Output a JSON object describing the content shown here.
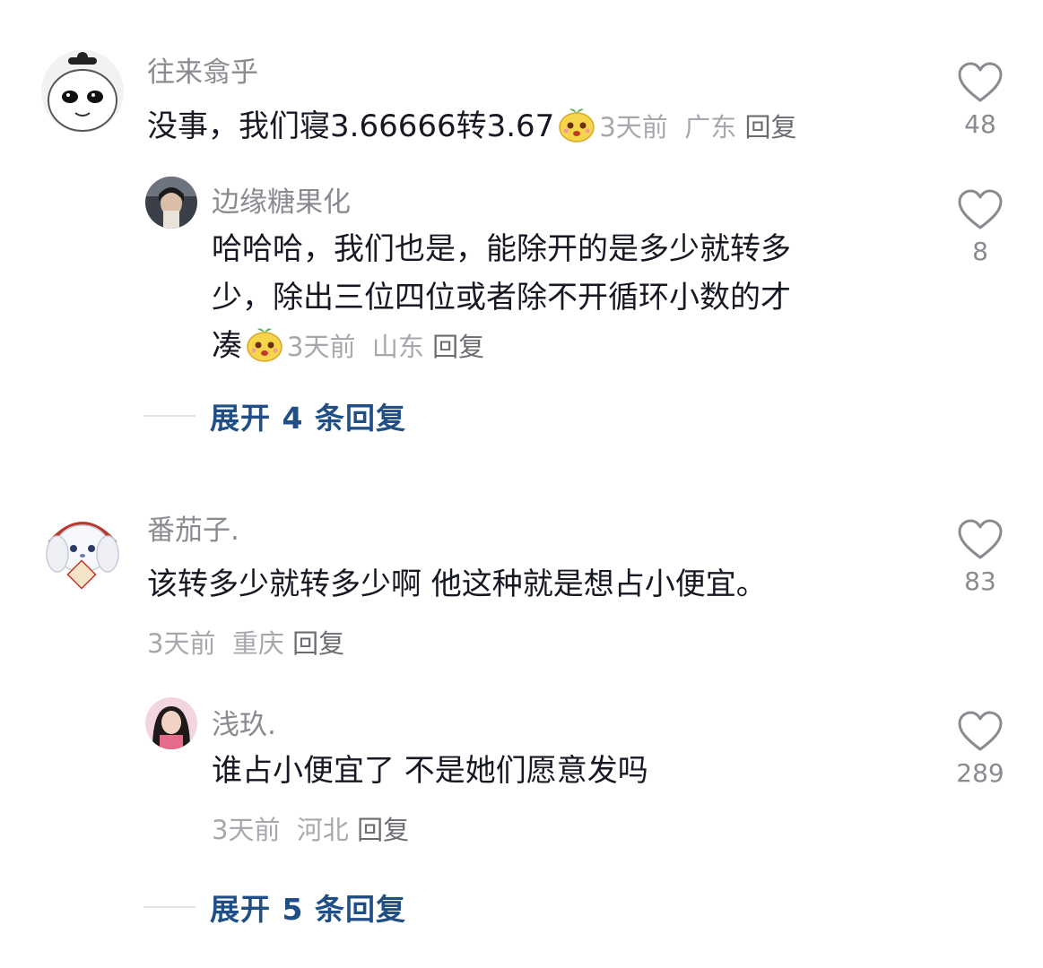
{
  "comments": [
    {
      "username": "往来翕乎",
      "text": "没事，我们寝3.66666转3.67",
      "time": "3天前",
      "location": "广东",
      "reply_label": "回复",
      "likes": "48",
      "replies": [
        {
          "username": "边缘糖果化",
          "line1": "哈哈哈，我们也是，能除开的是多少就转多",
          "line2": "少，除出三位四位或者除不开循环小数的才",
          "line3": "凑",
          "time": "3天前",
          "location": "山东",
          "reply_label": "回复",
          "likes": "8"
        }
      ],
      "expand_label": "展开 4 条回复"
    },
    {
      "username": "番茄子.",
      "text": "该转多少就转多少啊 他这种就是想占小便宜。",
      "time": "3天前",
      "location": "重庆",
      "reply_label": "回复",
      "likes": "83",
      "replies": [
        {
          "username": "浅玖.",
          "line1": "谁占小便宜了 不是她们愿意发吗",
          "time": "3天前",
          "location": "河北",
          "reply_label": "回复",
          "likes": "289"
        }
      ],
      "expand_label": "展开 5 条回复"
    }
  ],
  "icons": {
    "like": "heart-outline-icon",
    "emoji": "yellow-face-emoji-icon"
  },
  "colors": {
    "username": "#8a8b91",
    "meta": "#a7a8ad",
    "expand": "#1f4f86"
  }
}
